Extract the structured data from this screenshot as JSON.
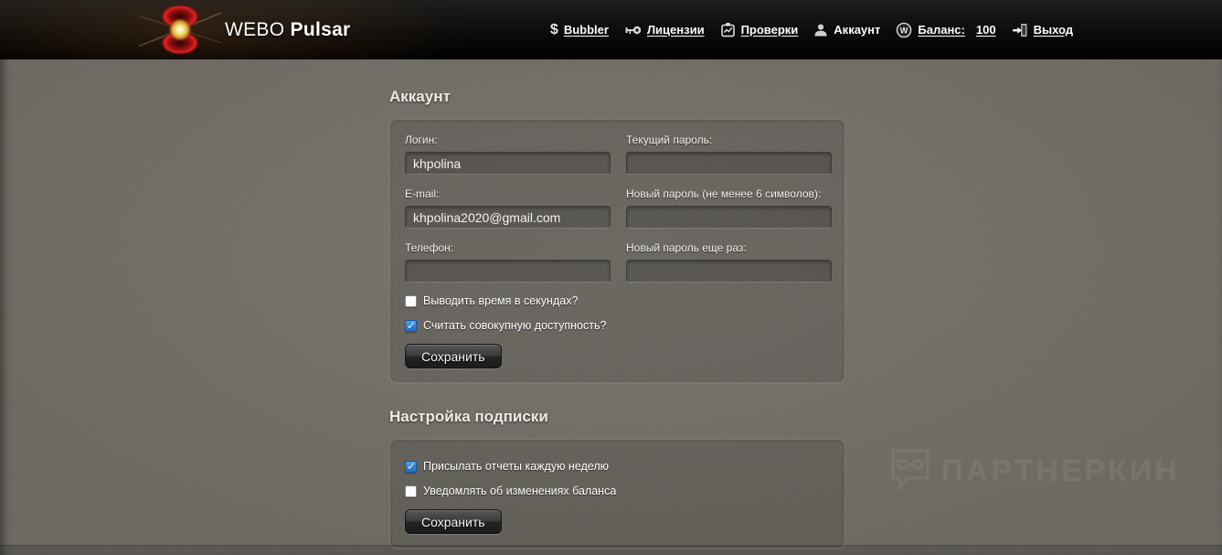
{
  "header": {
    "logo": {
      "brand": "WEBO",
      "product": "Pulsar"
    },
    "nav": [
      {
        "label": "Bubbler",
        "icon": "dollar-icon"
      },
      {
        "label": "Лицензии",
        "icon": "key-icon"
      },
      {
        "label": "Проверки",
        "icon": "checks-clipboard-icon"
      },
      {
        "label": "Аккаунт",
        "icon": "user-icon"
      },
      {
        "label": "Баланс:",
        "value": "100",
        "icon": "webmoney-icon"
      },
      {
        "label": "Выход",
        "icon": "exit-door-icon"
      }
    ]
  },
  "account_section": {
    "title": "Аккаунт",
    "fields": {
      "login": {
        "label": "Логин:",
        "value": "khpolina"
      },
      "current_password": {
        "label": "Текущий пароль:",
        "value": ""
      },
      "email": {
        "label": "E-mail:",
        "value": "khpolina2020@gmail.com"
      },
      "new_password": {
        "label": "Новый пароль (не менее 6 символов):",
        "value": ""
      },
      "phone": {
        "label": "Телефон:",
        "value": ""
      },
      "new_password_repeat": {
        "label": "Новый пароль еще раз:",
        "value": ""
      }
    },
    "checkboxes": [
      {
        "label": "Выводить время в секундах?",
        "checked": false
      },
      {
        "label": "Считать совокупную доступность?",
        "checked": true
      }
    ],
    "save_label": "Сохранить"
  },
  "subscription_section": {
    "title": "Настройка подписки",
    "checkboxes": [
      {
        "label": "Присылать отчеты каждую неделю",
        "checked": true
      },
      {
        "label": "Уведомлять об изменениях баланса",
        "checked": false
      }
    ],
    "save_label": "Сохранить"
  },
  "watermark": {
    "text": "ПАРТНЕРКИН"
  },
  "colors": {
    "page_bg": "#6f6b64",
    "header_bg": "#0b0b0b",
    "accent_checkbox_blue": "#2f80d9",
    "logo_red": "#c01414",
    "logo_core": "#f5e77a"
  }
}
